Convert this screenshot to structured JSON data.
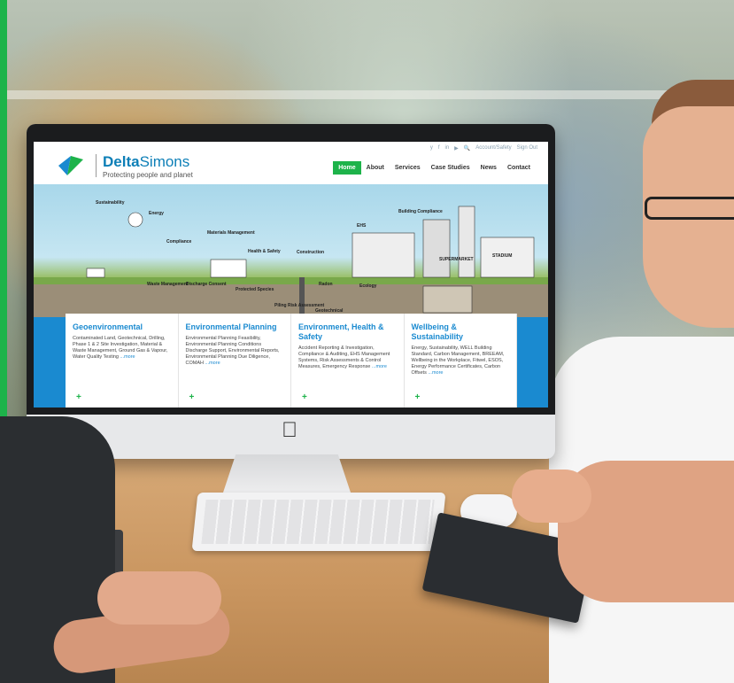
{
  "site": {
    "brand_bold": "Delta",
    "brand_thin": "Simons",
    "tagline": "Protecting people and planet",
    "social": [
      "y",
      "f",
      "in",
      "▶",
      "🔍",
      "Account/Safety",
      "Sign Out"
    ],
    "menu": [
      "Home",
      "About",
      "Services",
      "Case Studies",
      "News",
      "Contact"
    ],
    "hero_labels": [
      "Sustainability",
      "Energy",
      "Compliance",
      "Materials Management",
      "Health & Safety",
      "Construction",
      "Building Compliance",
      "EHS",
      "Waste Management",
      "Discharge Consent",
      "Protected Species",
      "Radon",
      "Ecology",
      "Piling Risk Assessment",
      "Geotechnical",
      "SUPERMARKET",
      "STADIUM"
    ],
    "cards": [
      {
        "title": "Geoenvironmental",
        "text": "Contaminated Land, Geotechnical, Drilling, Phase 1 & 2 Site Investigation, Material & Waste Management, Ground Gas & Vapour, Water Quality Testing",
        "more": "...more"
      },
      {
        "title": "Environmental Planning",
        "text": "Environmental Planning Feasibility, Environmental Planning Conditions Discharge Support, Environmental Reports, Environmental Planning Due Diligence, COMAH",
        "more": "...more"
      },
      {
        "title": "Environment, Health & Safety",
        "text": "Accident Reporting & Investigation, Compliance & Auditing, EHS Management Systems, Risk Assessments & Control Measures, Emergency Response",
        "more": "...more"
      },
      {
        "title": "Wellbeing & Sustainability",
        "text": "Energy, Sustainability, WELL Building Standard, Carbon Management, BREEAM, Wellbeing in the Workplace, Fitwel, ESOS, Energy Performance Certificates, Carbon Offsets",
        "more": "...more"
      }
    ]
  },
  "colors": {
    "accent_green": "#1db34a",
    "brand_blue": "#1a8ad0"
  }
}
